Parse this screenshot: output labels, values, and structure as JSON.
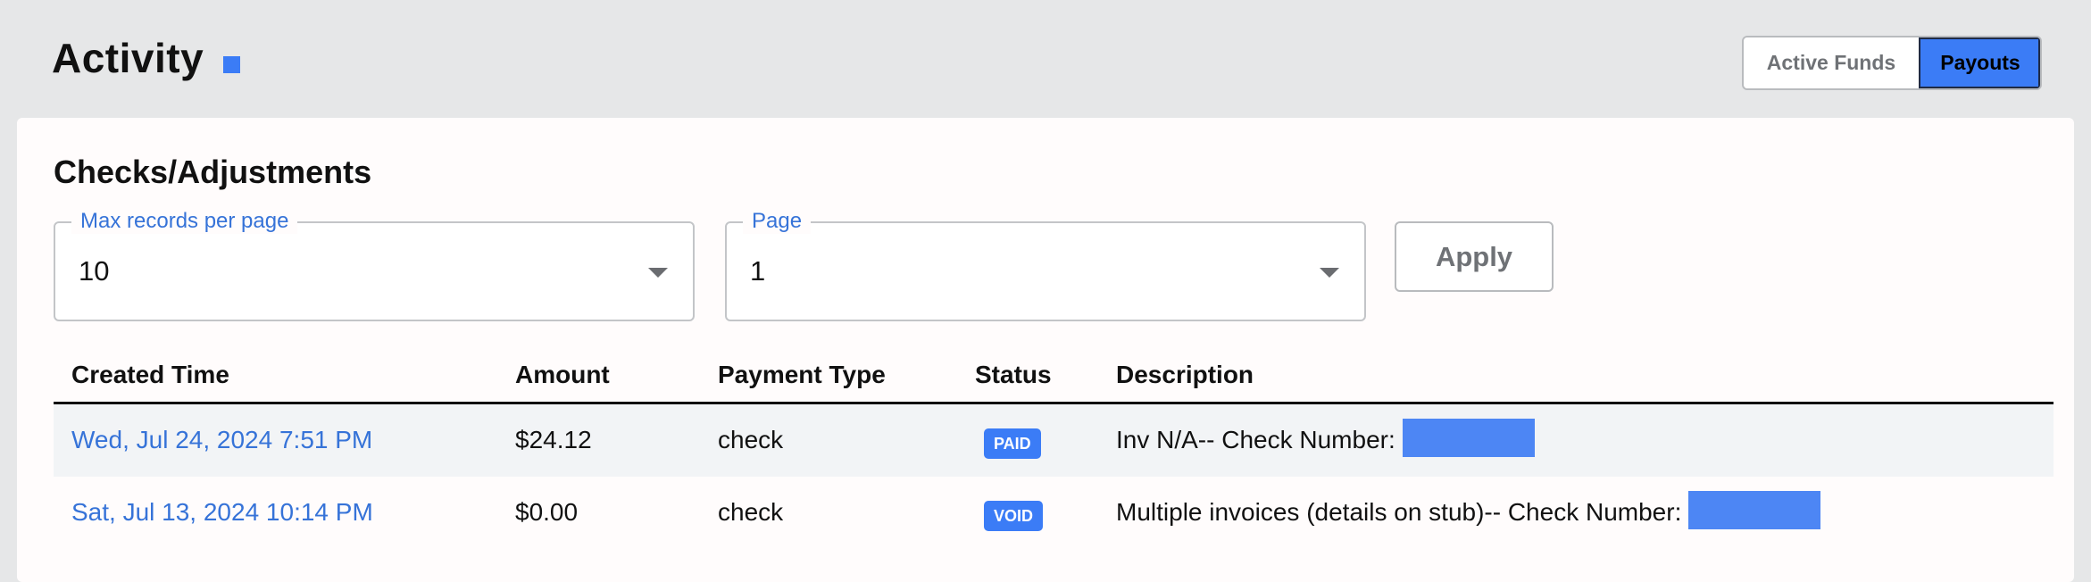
{
  "header": {
    "title": "Activity",
    "accent_color": "#3b7cf6",
    "toggle": {
      "active_funds_label": "Active Funds",
      "payouts_label": "Payouts",
      "selected": "Payouts"
    }
  },
  "section": {
    "title": "Checks/Adjustments"
  },
  "filters": {
    "max_records": {
      "label": "Max records per page",
      "value": "10"
    },
    "page": {
      "label": "Page",
      "value": "1"
    },
    "apply_label": "Apply"
  },
  "table": {
    "columns": [
      "Created Time",
      "Amount",
      "Payment Type",
      "Status",
      "Description"
    ],
    "rows": [
      {
        "created_time": "Wed, Jul 24, 2024 7:51 PM",
        "amount": "$24.12",
        "payment_type": "check",
        "status": "PAID",
        "description": "Inv N/A-- Check Number:"
      },
      {
        "created_time": "Sat, Jul 13, 2024 10:14 PM",
        "amount": "$0.00",
        "payment_type": "check",
        "status": "VOID",
        "description": "Multiple invoices (details on stub)-- Check Number:"
      }
    ]
  }
}
